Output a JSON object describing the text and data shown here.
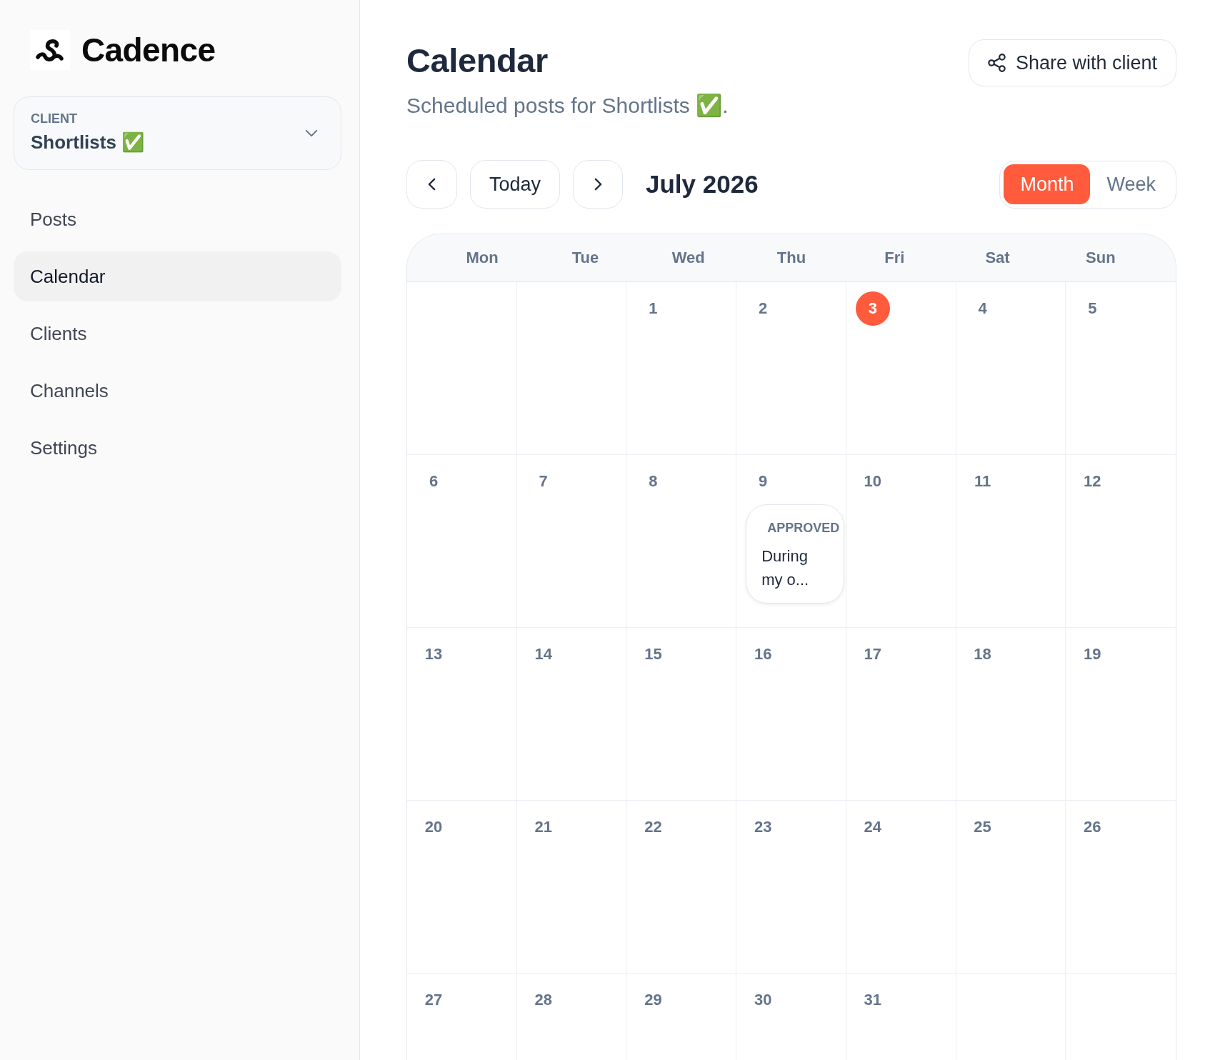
{
  "sidebar": {
    "brand": "Cadence",
    "client_picker": {
      "label": "CLIENT",
      "value": "Shortlists ✅"
    },
    "nav": [
      {
        "label": "Posts",
        "selected": false
      },
      {
        "label": "Calendar",
        "selected": true
      },
      {
        "label": "Clients",
        "selected": false
      },
      {
        "label": "Channels",
        "selected": false
      },
      {
        "label": "Settings",
        "selected": false
      }
    ]
  },
  "header": {
    "title": "Calendar",
    "subtitle": "Scheduled posts for Shortlists ✅.",
    "share_button": "Share with client"
  },
  "toolbar": {
    "today_button": "Today",
    "month_label": "July 2026",
    "views": [
      {
        "label": "Month",
        "selected": true
      },
      {
        "label": "Week",
        "selected": false
      }
    ]
  },
  "calendar": {
    "weekdays": [
      "Mon",
      "Tue",
      "Wed",
      "Thu",
      "Fri",
      "Sat",
      "Sun"
    ],
    "weeks": [
      [
        {
          "kind": "empty"
        },
        {
          "kind": "empty"
        },
        {
          "kind": "day",
          "day": "1",
          "today": false
        },
        {
          "kind": "day",
          "day": "2",
          "today": false
        },
        {
          "kind": "day",
          "day": "3",
          "today": true
        },
        {
          "kind": "day",
          "day": "4",
          "today": false
        },
        {
          "kind": "day",
          "day": "5",
          "today": false
        }
      ],
      [
        {
          "kind": "day",
          "day": "6",
          "today": false
        },
        {
          "kind": "day",
          "day": "7",
          "today": false
        },
        {
          "kind": "day",
          "day": "8",
          "today": false
        },
        {
          "kind": "day",
          "day": "9",
          "today": false,
          "posts": [
            {
              "status": "APPROVED",
              "excerpt": "During my o..."
            }
          ]
        },
        {
          "kind": "day",
          "day": "10",
          "today": false
        },
        {
          "kind": "day",
          "day": "11",
          "today": false
        },
        {
          "kind": "day",
          "day": "12",
          "today": false
        }
      ],
      [
        {
          "kind": "day",
          "day": "13",
          "today": false
        },
        {
          "kind": "day",
          "day": "14",
          "today": false
        },
        {
          "kind": "day",
          "day": "15",
          "today": false
        },
        {
          "kind": "day",
          "day": "16",
          "today": false
        },
        {
          "kind": "day",
          "day": "17",
          "today": false
        },
        {
          "kind": "day",
          "day": "18",
          "today": false
        },
        {
          "kind": "day",
          "day": "19",
          "today": false
        }
      ],
      [
        {
          "kind": "day",
          "day": "20",
          "today": false
        },
        {
          "kind": "day",
          "day": "21",
          "today": false
        },
        {
          "kind": "day",
          "day": "22",
          "today": false
        },
        {
          "kind": "day",
          "day": "23",
          "today": false
        },
        {
          "kind": "day",
          "day": "24",
          "today": false
        },
        {
          "kind": "day",
          "day": "25",
          "today": false
        },
        {
          "kind": "day",
          "day": "26",
          "today": false
        }
      ],
      [
        {
          "kind": "day",
          "day": "27",
          "today": false
        },
        {
          "kind": "day",
          "day": "28",
          "today": false
        },
        {
          "kind": "day",
          "day": "29",
          "today": false
        },
        {
          "kind": "day",
          "day": "30",
          "today": false
        },
        {
          "kind": "day",
          "day": "31",
          "today": false
        },
        {
          "kind": "empty"
        },
        {
          "kind": "empty"
        }
      ]
    ]
  }
}
